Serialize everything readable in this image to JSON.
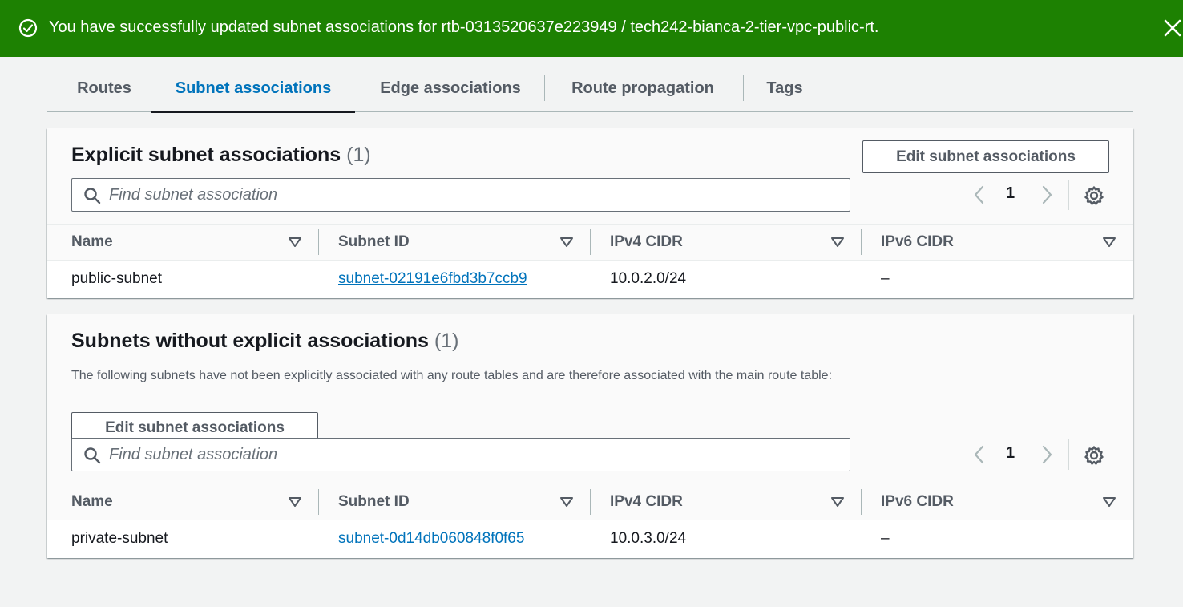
{
  "flash": {
    "message": "You have successfully updated subnet associations for rtb-0313520637e223949 / tech242-bianca-2-tier-vpc-public-rt.",
    "icon": "check-circle-icon",
    "close_icon": "close-icon",
    "color": "#1d8102"
  },
  "tabs": [
    {
      "label": "Routes",
      "active": false
    },
    {
      "label": "Subnet associations",
      "active": true
    },
    {
      "label": "Edge associations",
      "active": false
    },
    {
      "label": "Route propagation",
      "active": false
    },
    {
      "label": "Tags",
      "active": false
    }
  ],
  "explicit": {
    "title": "Explicit subnet associations",
    "count": "(1)",
    "edit_button": "Edit subnet associations",
    "search_placeholder": "Find subnet association",
    "page": "1",
    "columns": [
      "Name",
      "Subnet ID",
      "IPv4 CIDR",
      "IPv6 CIDR"
    ],
    "rows": [
      {
        "name": "public-subnet",
        "subnet_id": "subnet-02191e6fbd3b7ccb9",
        "ipv4": "10.0.2.0/24",
        "ipv6": "–"
      }
    ]
  },
  "without": {
    "title": "Subnets without explicit associations",
    "count": "(1)",
    "description": "The following subnets have not been explicitly associated with any route tables and are therefore associated with the main route table:",
    "edit_button": "Edit subnet associations",
    "search_placeholder": "Find subnet association",
    "page": "1",
    "columns": [
      "Name",
      "Subnet ID",
      "IPv4 CIDR",
      "IPv6 CIDR"
    ],
    "rows": [
      {
        "name": "private-subnet",
        "subnet_id": "subnet-0d14db060848f0f65",
        "ipv4": "10.0.3.0/24",
        "ipv6": "–"
      }
    ]
  },
  "colors": {
    "link": "#0073bb",
    "success": "#1d8102",
    "text": "#16191f"
  }
}
